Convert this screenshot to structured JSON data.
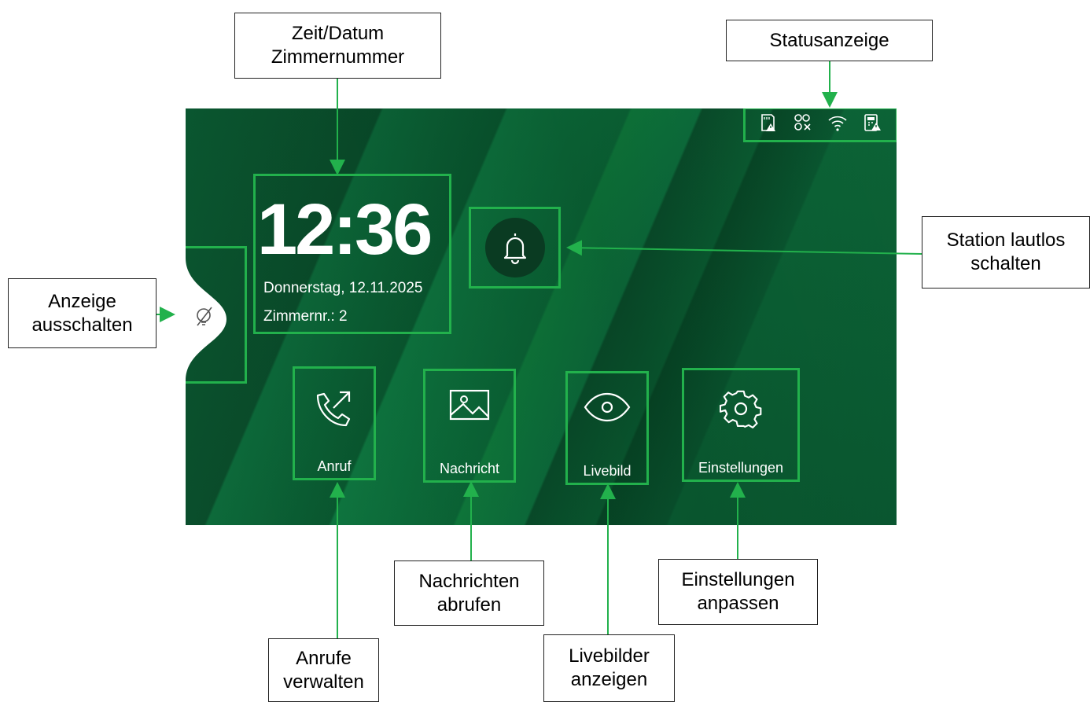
{
  "screen": {
    "clock": {
      "time": "12:36",
      "date": "Donnerstag, 12.11.2025",
      "room": "Zimmernr.: 2"
    },
    "status_icons": [
      "sd-card-warning-icon",
      "no-link-icon",
      "wifi-icon",
      "device-warning-icon"
    ],
    "tiles": [
      {
        "label": "Anruf",
        "icon": "phone-outgoing-icon"
      },
      {
        "label": "Nachricht",
        "icon": "image-icon"
      },
      {
        "label": "Livebild",
        "icon": "eye-icon"
      },
      {
        "label": "Einstellungen",
        "icon": "gear-icon"
      }
    ],
    "mute_icon": "bell-icon",
    "display_off_icon": "bulb-off-icon"
  },
  "callouts": {
    "time_date": "Zeit/Datum\nZimmernummer",
    "status": "Statusanzeige",
    "mute": "Station lautlos\nschalten",
    "display_off": "Anzeige\nausschalten",
    "calls": "Anrufe\nverwalten",
    "messages": "Nachrichten\nabrufen",
    "live": "Livebilder\nanzeigen",
    "settings": "Einstellungen\nanpassen"
  },
  "colors": {
    "accent": "#22b14c",
    "screen_bg": "#0b5e33",
    "mute_circle": "#0a3b22"
  }
}
